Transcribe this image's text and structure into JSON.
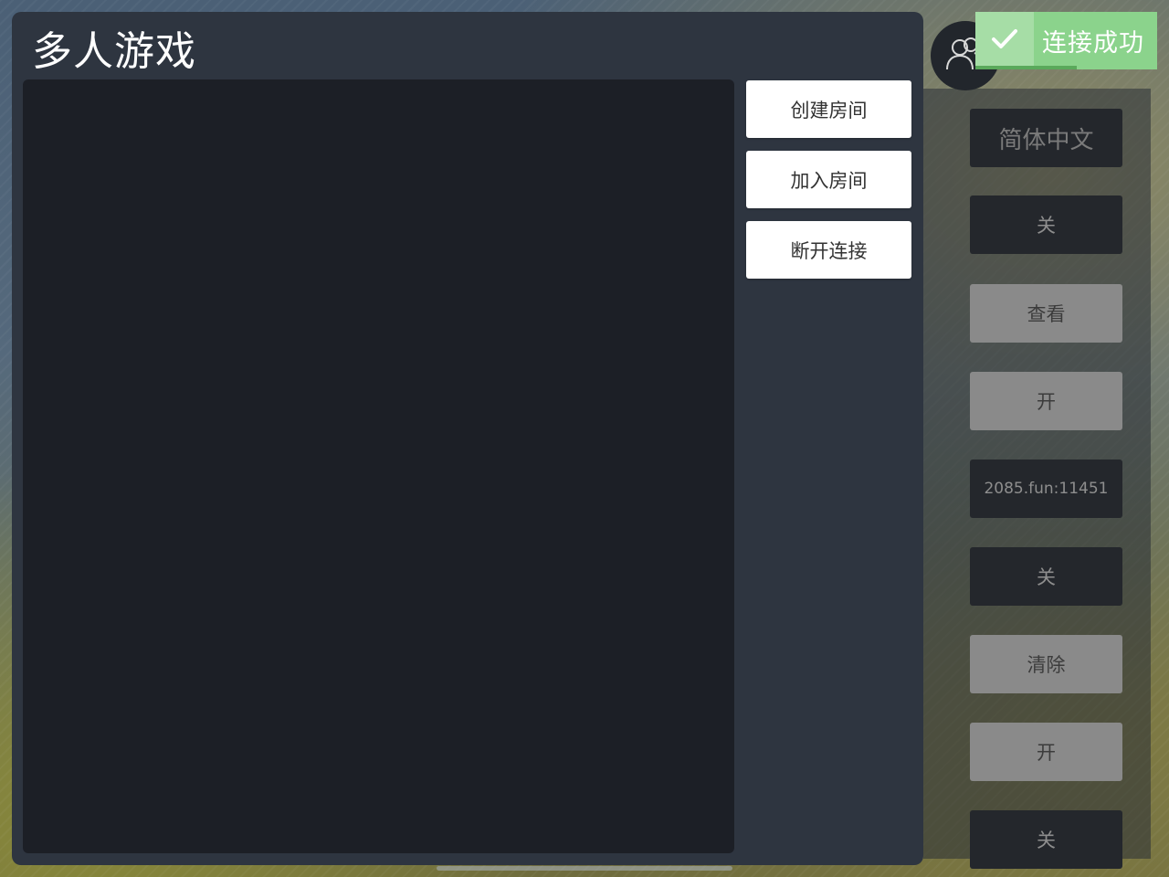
{
  "dialog": {
    "title": "多人游戏",
    "buttons": {
      "create_room": "创建房间",
      "join_room": "加入房间",
      "disconnect": "断开连接"
    }
  },
  "settings": {
    "items": [
      {
        "label": "简体中文",
        "style": "lang"
      },
      {
        "label": "关",
        "style": "dark"
      },
      {
        "label": "查看",
        "style": "light"
      },
      {
        "label": "开",
        "style": "light"
      },
      {
        "label": "2085.fun:11451",
        "style": "server"
      },
      {
        "label": "关",
        "style": "dark"
      },
      {
        "label": "清除",
        "style": "light"
      },
      {
        "label": "开",
        "style": "light"
      },
      {
        "label": "关",
        "style": "dark"
      }
    ]
  },
  "avatar": {
    "icon": "users-icon"
  },
  "toast": {
    "text": "连接成功",
    "icon": "check-icon",
    "color": "#8bd38c",
    "progress": 0.56
  }
}
